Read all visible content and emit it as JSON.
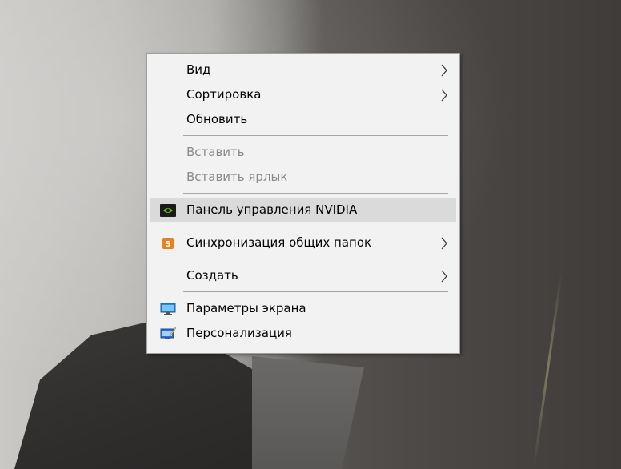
{
  "desktop": {
    "wallpaper": "granite-rock-photo"
  },
  "context_menu": {
    "groups": [
      [
        {
          "label": "Вид",
          "submenu": true,
          "disabled": false,
          "icon": null
        },
        {
          "label": "Сортировка",
          "submenu": true,
          "disabled": false,
          "icon": null
        },
        {
          "label": "Обновить",
          "submenu": false,
          "disabled": false,
          "icon": null
        }
      ],
      [
        {
          "label": "Вставить",
          "submenu": false,
          "disabled": true,
          "icon": null
        },
        {
          "label": "Вставить ярлык",
          "submenu": false,
          "disabled": true,
          "icon": null
        }
      ],
      [
        {
          "label": "Панель управления NVIDIA",
          "submenu": false,
          "disabled": false,
          "icon": "nvidia-icon",
          "highlighted": true
        }
      ],
      [
        {
          "label": "Синхронизация общих папок",
          "submenu": true,
          "disabled": false,
          "icon": "sync-folders-icon"
        }
      ],
      [
        {
          "label": "Создать",
          "submenu": true,
          "disabled": false,
          "icon": null
        }
      ],
      [
        {
          "label": "Параметры экрана",
          "submenu": false,
          "disabled": false,
          "icon": "display-settings-icon"
        },
        {
          "label": "Персонализация",
          "submenu": false,
          "disabled": false,
          "icon": "personalization-icon"
        }
      ]
    ]
  },
  "colors": {
    "menu_background": "#f2f2f2",
    "menu_border": "#a0a0a0",
    "highlight": "#dadada",
    "disabled_text": "#8a8a8a",
    "nvidia_green": "#76b900",
    "sync_orange": "#e8821e",
    "display_blue": "#2a8fd6"
  }
}
